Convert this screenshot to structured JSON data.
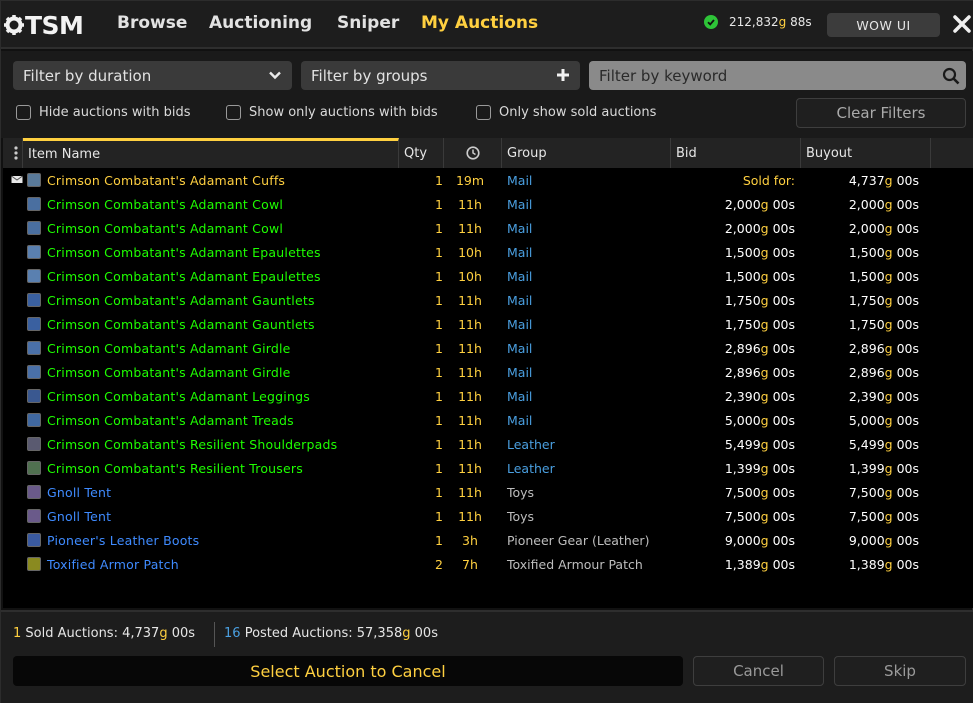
{
  "header": {
    "logo_text": "TSM",
    "nav": [
      {
        "label": "Browse",
        "active": false
      },
      {
        "label": "Auctioning",
        "active": false
      },
      {
        "label": "Sniper",
        "active": false
      },
      {
        "label": "My Auctions",
        "active": true
      }
    ],
    "gold": {
      "gold": "212,832",
      "gold_unit": "g",
      "silver": "88",
      "silver_unit": "s"
    },
    "wow_ui_label": "WOW UI",
    "close_icon": "close-icon"
  },
  "filters": {
    "duration_label": "Filter by duration",
    "groups_label": "Filter by groups",
    "keyword_placeholder": "Filter by keyword",
    "checkboxes": [
      {
        "label": "Hide auctions with bids",
        "checked": false
      },
      {
        "label": "Show only auctions with bids",
        "checked": false
      },
      {
        "label": "Only show sold auctions",
        "checked": false
      }
    ],
    "clear_label": "Clear Filters"
  },
  "table": {
    "columns": [
      "Item Name",
      "Qty",
      "",
      "Group",
      "Bid",
      "Buyout"
    ],
    "rows": [
      {
        "name": "Crimson Combatant's Adamant Cuffs",
        "color": "#ffd040",
        "qty": "1",
        "time": "19m",
        "group": "Mail",
        "group_color": "#4a9fe0",
        "bid": "Sold for:",
        "bid_gold": "",
        "bid_silver": "",
        "buyout_gold": "4,737",
        "buyout_silver": "00",
        "sold": true,
        "icon_color": "#5a7a9a"
      },
      {
        "name": "Crimson Combatant's Adamant Cowl",
        "color": "#1eff00",
        "qty": "1",
        "time": "11h",
        "group": "Mail",
        "group_color": "#4a9fe0",
        "bid": "",
        "bid_gold": "2,000",
        "bid_silver": "00",
        "buyout_gold": "2,000",
        "buyout_silver": "00",
        "sold": false,
        "icon_color": "#4a6fa0"
      },
      {
        "name": "Crimson Combatant's Adamant Cowl",
        "color": "#1eff00",
        "qty": "1",
        "time": "11h",
        "group": "Mail",
        "group_color": "#4a9fe0",
        "bid": "",
        "bid_gold": "2,000",
        "bid_silver": "00",
        "buyout_gold": "2,000",
        "buyout_silver": "00",
        "sold": false,
        "icon_color": "#4a6fa0"
      },
      {
        "name": "Crimson Combatant's Adamant Epaulettes",
        "color": "#1eff00",
        "qty": "1",
        "time": "10h",
        "group": "Mail",
        "group_color": "#4a9fe0",
        "bid": "",
        "bid_gold": "1,500",
        "bid_silver": "00",
        "buyout_gold": "1,500",
        "buyout_silver": "00",
        "sold": false,
        "icon_color": "#5a80b0"
      },
      {
        "name": "Crimson Combatant's Adamant Epaulettes",
        "color": "#1eff00",
        "qty": "1",
        "time": "10h",
        "group": "Mail",
        "group_color": "#4a9fe0",
        "bid": "",
        "bid_gold": "1,500",
        "bid_silver": "00",
        "buyout_gold": "1,500",
        "buyout_silver": "00",
        "sold": false,
        "icon_color": "#5a80b0"
      },
      {
        "name": "Crimson Combatant's Adamant Gauntlets",
        "color": "#1eff00",
        "qty": "1",
        "time": "11h",
        "group": "Mail",
        "group_color": "#4a9fe0",
        "bid": "",
        "bid_gold": "1,750",
        "bid_silver": "00",
        "buyout_gold": "1,750",
        "buyout_silver": "00",
        "sold": false,
        "icon_color": "#3a60a0"
      },
      {
        "name": "Crimson Combatant's Adamant Gauntlets",
        "color": "#1eff00",
        "qty": "1",
        "time": "11h",
        "group": "Mail",
        "group_color": "#4a9fe0",
        "bid": "",
        "bid_gold": "1,750",
        "bid_silver": "00",
        "buyout_gold": "1,750",
        "buyout_silver": "00",
        "sold": false,
        "icon_color": "#3a60a0"
      },
      {
        "name": "Crimson Combatant's Adamant Girdle",
        "color": "#1eff00",
        "qty": "1",
        "time": "11h",
        "group": "Mail",
        "group_color": "#4a9fe0",
        "bid": "",
        "bid_gold": "2,896",
        "bid_silver": "00",
        "buyout_gold": "2,896",
        "buyout_silver": "00",
        "sold": false,
        "icon_color": "#4a70a8"
      },
      {
        "name": "Crimson Combatant's Adamant Girdle",
        "color": "#1eff00",
        "qty": "1",
        "time": "11h",
        "group": "Mail",
        "group_color": "#4a9fe0",
        "bid": "",
        "bid_gold": "2,896",
        "bid_silver": "00",
        "buyout_gold": "2,896",
        "buyout_silver": "00",
        "sold": false,
        "icon_color": "#4a70a8"
      },
      {
        "name": "Crimson Combatant's Adamant Leggings",
        "color": "#1eff00",
        "qty": "1",
        "time": "11h",
        "group": "Mail",
        "group_color": "#4a9fe0",
        "bid": "",
        "bid_gold": "2,390",
        "bid_silver": "00",
        "buyout_gold": "2,390",
        "buyout_silver": "00",
        "sold": false,
        "icon_color": "#3a5890"
      },
      {
        "name": "Crimson Combatant's Adamant Treads",
        "color": "#1eff00",
        "qty": "1",
        "time": "11h",
        "group": "Mail",
        "group_color": "#4a9fe0",
        "bid": "",
        "bid_gold": "5,000",
        "bid_silver": "00",
        "buyout_gold": "5,000",
        "buyout_silver": "00",
        "sold": false,
        "icon_color": "#4068a0"
      },
      {
        "name": "Crimson Combatant's Resilient Shoulderpads",
        "color": "#1eff00",
        "qty": "1",
        "time": "11h",
        "group": "Leather",
        "group_color": "#4a9fe0",
        "bid": "",
        "bid_gold": "5,499",
        "bid_silver": "00",
        "buyout_gold": "5,499",
        "buyout_silver": "00",
        "sold": false,
        "icon_color": "#5a5a70"
      },
      {
        "name": "Crimson Combatant's Resilient Trousers",
        "color": "#1eff00",
        "qty": "1",
        "time": "11h",
        "group": "Leather",
        "group_color": "#4a9fe0",
        "bid": "",
        "bid_gold": "1,399",
        "bid_silver": "00",
        "buyout_gold": "1,399",
        "buyout_silver": "00",
        "sold": false,
        "icon_color": "#507050"
      },
      {
        "name": "Gnoll Tent",
        "color": "#3f8bff",
        "qty": "1",
        "time": "11h",
        "group": "Toys",
        "group_color": "#bdbdbd",
        "bid": "",
        "bid_gold": "7,500",
        "bid_silver": "00",
        "buyout_gold": "7,500",
        "buyout_silver": "00",
        "sold": false,
        "icon_color": "#6a5a8a"
      },
      {
        "name": "Gnoll Tent",
        "color": "#3f8bff",
        "qty": "1",
        "time": "11h",
        "group": "Toys",
        "group_color": "#bdbdbd",
        "bid": "",
        "bid_gold": "7,500",
        "bid_silver": "00",
        "buyout_gold": "7,500",
        "buyout_silver": "00",
        "sold": false,
        "icon_color": "#6a5a8a"
      },
      {
        "name": "Pioneer's Leather Boots",
        "color": "#3f8bff",
        "qty": "1",
        "time": "3h",
        "group": "Pioneer Gear (Leather)",
        "group_color": "#bdbdbd",
        "bid": "",
        "bid_gold": "9,000",
        "bid_silver": "00",
        "buyout_gold": "9,000",
        "buyout_silver": "00",
        "sold": false,
        "icon_color": "#3a5aa0"
      },
      {
        "name": "Toxified Armor Patch",
        "color": "#3f8bff",
        "qty": "2",
        "time": "7h",
        "group": "Toxified Armour Patch",
        "group_color": "#bdbdbd",
        "bid": "",
        "bid_gold": "1,389",
        "bid_silver": "00",
        "buyout_gold": "1,389",
        "buyout_silver": "00",
        "sold": false,
        "icon_color": "#8a8a20"
      }
    ]
  },
  "footer": {
    "sold_count": "1",
    "sold_label": "Sold Auctions:",
    "sold_gold": "4,737",
    "sold_silver": "00",
    "posted_count": "16",
    "posted_label": "Posted Auctions:",
    "posted_gold": "57,358",
    "posted_silver": "00",
    "select_label": "Select Auction to Cancel",
    "cancel_label": "Cancel",
    "skip_label": "Skip"
  },
  "colors": {
    "accent": "#ffd040",
    "uncommon": "#1eff00",
    "rare": "#3f8bff",
    "group": "#4a9fe0"
  }
}
